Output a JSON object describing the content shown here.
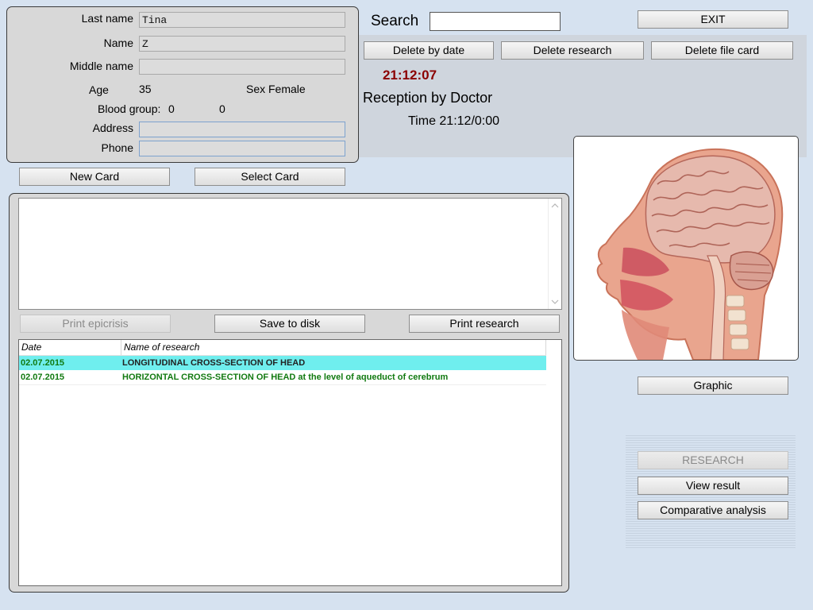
{
  "patient": {
    "last_name_label": "Last name",
    "last_name_value": "Tina",
    "name_label": "Name",
    "name_value": "Z",
    "middle_name_label": "Middle name",
    "middle_name_value": "",
    "age_label": "Age",
    "age_value": "35",
    "sex_label": "Sex",
    "sex_value": "Female",
    "blood_group_label": "Blood group:",
    "blood_group_value": "0",
    "rh_value": "0",
    "address_label": "Address",
    "address_value": "",
    "phone_label": "Phone",
    "phone_value": ""
  },
  "search": {
    "label": "Search",
    "value": ""
  },
  "toolbar": {
    "exit_label": "EXIT",
    "delete_by_date_label": "Delete by date",
    "delete_research_label": "Delete research",
    "delete_file_card_label": "Delete file card"
  },
  "status": {
    "clock": "21:12:07",
    "reception_text": "Reception by Doctor",
    "time_text": "Time 21:12/0:00"
  },
  "cards": {
    "new_card_label": "New Card",
    "select_card_label": "Select Card"
  },
  "notes": {
    "text": ""
  },
  "actions": {
    "print_epicrisis_label": "Print epicrisis",
    "save_to_disk_label": "Save to disk",
    "print_research_label": "Print research"
  },
  "research_list": {
    "columns": [
      "Date",
      "Name of research"
    ],
    "rows": [
      {
        "date": "02.07.2015",
        "name": "LONGITUDINAL CROSS-SECTION OF HEAD",
        "selected": true
      },
      {
        "date": "02.07.2015",
        "name": "HORIZONTAL CROSS-SECTION OF HEAD at the level of aqueduct of cerebrum",
        "selected": false
      }
    ]
  },
  "side_buttons": {
    "graphic_label": "Graphic",
    "research_label": "RESEARCH",
    "view_result_label": "View result",
    "comparative_analysis_label": "Comparative analysis"
  },
  "colors": {
    "clock": "#8b0000",
    "row_text": "#117a11",
    "row_selected_bg": "#6feeee",
    "background": "#d6e2f0"
  }
}
